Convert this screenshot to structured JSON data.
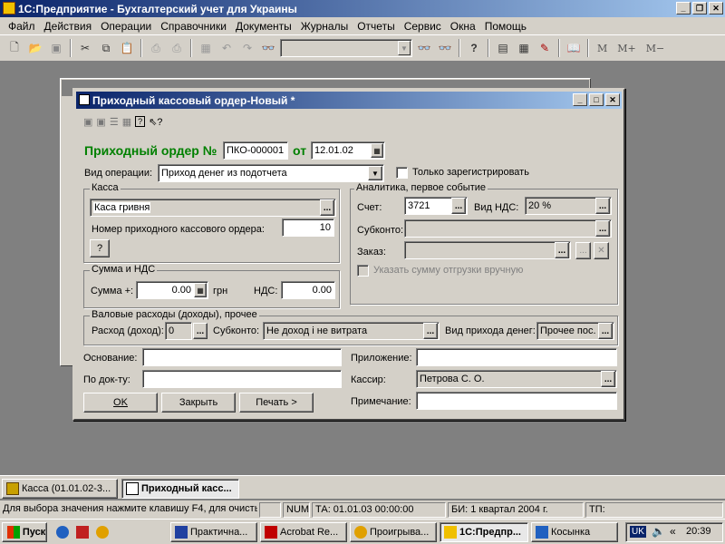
{
  "app": {
    "title": "1С:Предприятие - Бухгалтерский учет для Украины"
  },
  "menu": [
    "Файл",
    "Действия",
    "Операции",
    "Справочники",
    "Документы",
    "Журналы",
    "Отчеты",
    "Сервис",
    "Окна",
    "Помощь"
  ],
  "toolbar": {
    "m_label": "M",
    "mplus_label": "M+",
    "mminus_label": "M−"
  },
  "dialog": {
    "title": "Приходный кассовый ордер-Новый *",
    "heading": "Приходный ордер №",
    "number": "ПКО-000001",
    "from_label": "от",
    "date": "12.01.02",
    "op_type_label": "Вид операции:",
    "op_type_value": "Приход денег из подотчета",
    "only_registered_label": "Только зарегистрировать",
    "kassa": {
      "group_title": "Касса",
      "value": "Каса гривня",
      "order_number_label": "Номер приходного кассового ордера:",
      "order_number_value": "10",
      "help_label": "?"
    },
    "sum": {
      "group_title": "Сумма и НДС",
      "sum_label": "Сумма +:",
      "sum_value": "0.00",
      "currency": "грн",
      "vat_label": "НДС:",
      "vat_value": "0.00"
    },
    "analytics": {
      "group_title": "Аналитика, первое событие",
      "account_label": "Счет:",
      "account_value": "3721",
      "vat_type_label": "Вид НДС:",
      "vat_type_value": "20 %",
      "subconto_label": "Субконто:",
      "order_label": "Заказ:",
      "manual_shipment_label": "Указать сумму отгрузки вручную"
    },
    "gross": {
      "group_title": "Валовые расходы (доходы), прочее",
      "expense_label": "Расход (доход):",
      "expense_value": "0",
      "subconto_label": "Субконто:",
      "subconto_value": "Не доход і не витрата",
      "income_type_label": "Вид прихода денег:",
      "income_type_value": "Прочее пос."
    },
    "basis_label": "Основание:",
    "by_doc_label": "По док-ту:",
    "attachment_label": "Приложение:",
    "cashier_label": "Кассир:",
    "cashier_value": "Петрова С. О.",
    "note_label": "Примечание:",
    "ok_label": "OK",
    "close_label": "Закрыть",
    "print_label": "Печать >"
  },
  "mdi_tabs": [
    {
      "label": "Касса (01.01.02-3..."
    },
    {
      "label": "Приходный касс..."
    }
  ],
  "status": {
    "hint": "Для выбора значения нажмите клавишу F4, для очисть",
    "num": "NUM",
    "ta": "ТА: 01.01.03  00:00:00",
    "bi": "БИ: 1 квартал 2004 г.",
    "tp": "ТП:"
  },
  "taskbar": {
    "start_label": "Пуск",
    "tasks": [
      {
        "label": "Практична..."
      },
      {
        "label": "Acrobat Re..."
      },
      {
        "label": "Проигрыва..."
      },
      {
        "label": "1С:Предпр..."
      },
      {
        "label": "Косынка"
      }
    ],
    "lang": "UK",
    "clock": "20:39"
  }
}
